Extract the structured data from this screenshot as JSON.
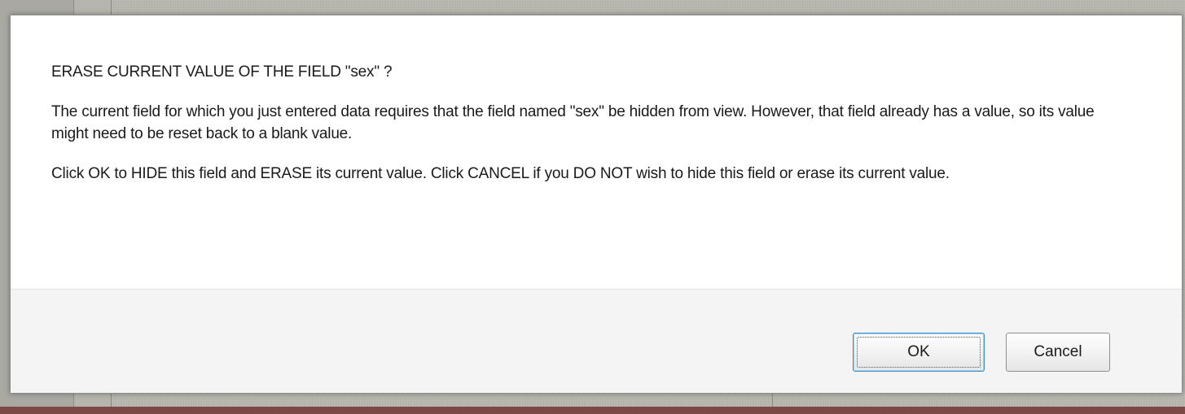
{
  "dialog": {
    "title": "ERASE CURRENT VALUE OF THE FIELD \"sex\" ?",
    "paragraph_1": "The current field for which you just entered data requires that the field named \"sex\" be hidden from view. However, that field already has a value, so its value might need to be reset back to a blank value.",
    "paragraph_2": "Click OK to HIDE this field and ERASE its current value. Click CANCEL if you DO NOT wish to hide this field or erase its current value.",
    "buttons": {
      "ok_label": "OK",
      "cancel_label": "Cancel"
    }
  },
  "colors": {
    "ok_button_border": "#3c8fc9",
    "footer_background": "#f4f4f4",
    "backdrop": "#b8b7af"
  }
}
